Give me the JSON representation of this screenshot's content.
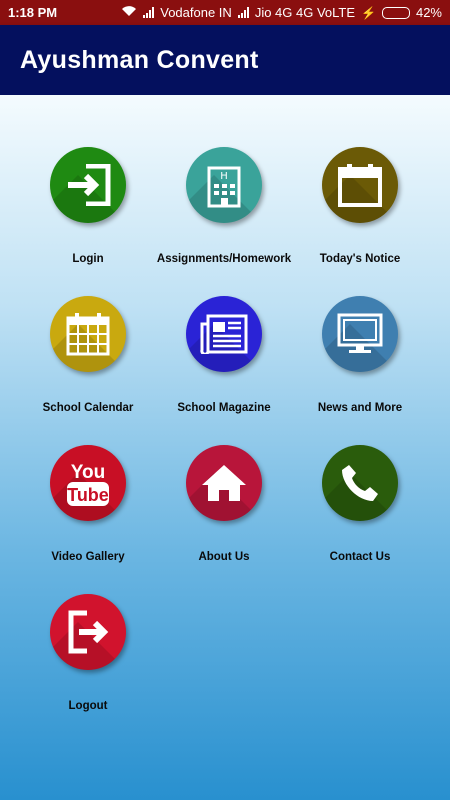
{
  "status_bar": {
    "time": "1:18 PM",
    "carrier1": "Vodafone IN",
    "carrier2": "Jio 4G 4G VoLTE",
    "battery": "42%",
    "battery_level": 0.42
  },
  "app_bar": {
    "title": "Ayushman Convent"
  },
  "menu": [
    {
      "label": "Login",
      "icon": "login-icon",
      "color": "#1f8a12"
    },
    {
      "label": "Assignments/Homework",
      "icon": "building-icon",
      "color": "#3aa39a"
    },
    {
      "label": "Today's Notice",
      "icon": "calendar-icon",
      "color": "#6b5a06"
    },
    {
      "label": "School Calendar",
      "icon": "calendar-grid-icon",
      "color": "#c9a90f"
    },
    {
      "label": "School Magazine",
      "icon": "newspaper-icon",
      "color": "#2a23d6"
    },
    {
      "label": "News and More",
      "icon": "monitor-icon",
      "color": "#3f7fb0"
    },
    {
      "label": "Video Gallery",
      "icon": "youtube-icon",
      "color": "#c80f25"
    },
    {
      "label": "About Us",
      "icon": "home-icon",
      "color": "#b8153a"
    },
    {
      "label": "Contact Us",
      "icon": "phone-icon",
      "color": "#2a5c0c"
    },
    {
      "label": "Logout",
      "icon": "logout-icon",
      "color": "#d1132d"
    }
  ]
}
